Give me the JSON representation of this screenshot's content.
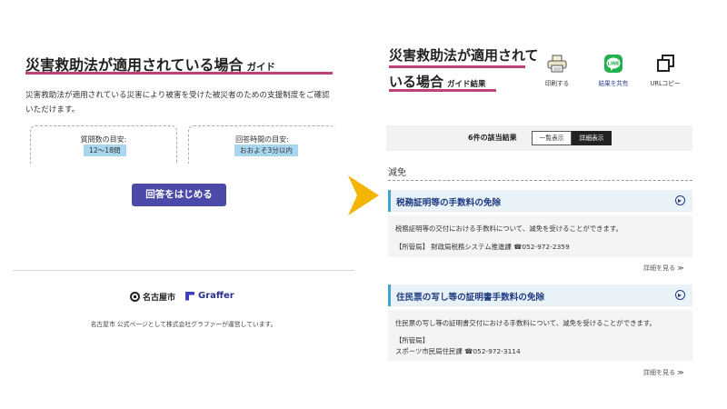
{
  "left": {
    "title": "災害救助法が適用されている場合",
    "title_suffix": "ガイド",
    "description": "災害救助法が適用されている災害により被害を受けた被災者のための支援制度をご確認いただけます。",
    "metrics": [
      {
        "label": "質問数の目安:",
        "value": "12～18問"
      },
      {
        "label": "回答時間の目安:",
        "value": "おおよそ3分以内"
      }
    ],
    "start_button": "回答をはじめる",
    "logos": {
      "city": "名古屋市",
      "company": "Graffer"
    },
    "footer": "名古屋市 公式ページとして株式会社グラファーが運営しています。"
  },
  "right": {
    "title_line1": "災害救助法が適用されて",
    "title_line2": "いる場合",
    "title_suffix": "ガイド結果",
    "actions": [
      {
        "label": "印刷する",
        "icon": "printer-icon"
      },
      {
        "label": "結果を共有",
        "icon": "line-icon",
        "icon_text": "LINE"
      },
      {
        "label": "URLコピー",
        "icon": "copy-icon"
      }
    ],
    "results_count": "6件の該当結果",
    "view_list": "一覧表示",
    "view_detail": "詳細表示",
    "section": "減免",
    "items": [
      {
        "title": "税務証明等の手数料の免除",
        "description": "税務証明等の交付における手数料について、減免を受けることができます。",
        "dept": "【所管局】 財政局税務システム推進課 ☎052-972-2359",
        "more": "詳細を見る ≫"
      },
      {
        "title": "住民票の写し等の証明書手数料の免除",
        "description": "住民票の写し等の証明書交付における手数料について、減免を受けることができます。",
        "dept_label": "【所管局】",
        "dept": "スポーツ市民局住民課 ☎052-972-3114",
        "more": "詳細を見る ≫"
      }
    ]
  },
  "colors": {
    "accent_pink": "#c0407a",
    "button_blue": "#4b4aa8",
    "arrow": "#f5b400",
    "link_navy": "#1f3c82"
  }
}
